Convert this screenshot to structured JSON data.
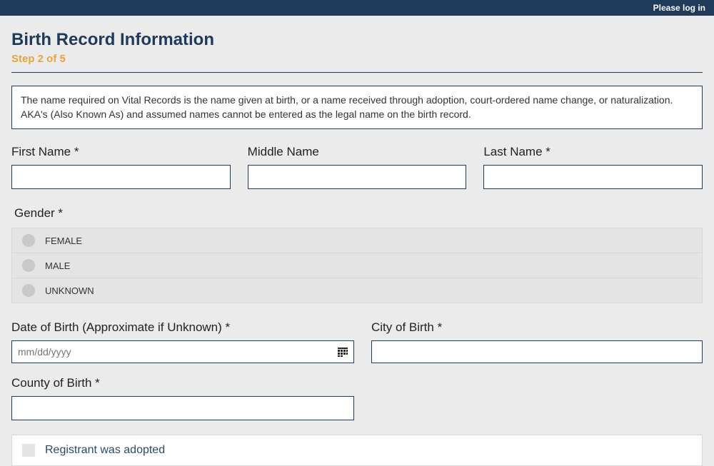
{
  "topbar": {
    "login_link": "Please log in"
  },
  "header": {
    "title": "Birth Record Information",
    "step": "Step 2 of 5"
  },
  "info_notice": "The name required on Vital Records is the name given at birth, or a name received through adoption, court-ordered name change, or naturalization. AKA's (Also Known As) and assumed names cannot be entered as the legal name on the birth record.",
  "fields": {
    "first_name": {
      "label": "First Name *",
      "value": ""
    },
    "middle_name": {
      "label": "Middle Name",
      "value": ""
    },
    "last_name": {
      "label": "Last Name *",
      "value": ""
    },
    "gender": {
      "label": "Gender *",
      "options": [
        "FEMALE",
        "MALE",
        "UNKNOWN"
      ]
    },
    "dob": {
      "label": "Date of Birth (Approximate if Unknown) *",
      "placeholder": "mm/dd/yyyy",
      "value": ""
    },
    "city": {
      "label": "City of Birth *",
      "value": ""
    },
    "county": {
      "label": "County of Birth *",
      "value": ""
    },
    "adopted": {
      "label": "Registrant was adopted",
      "checked": false
    }
  }
}
